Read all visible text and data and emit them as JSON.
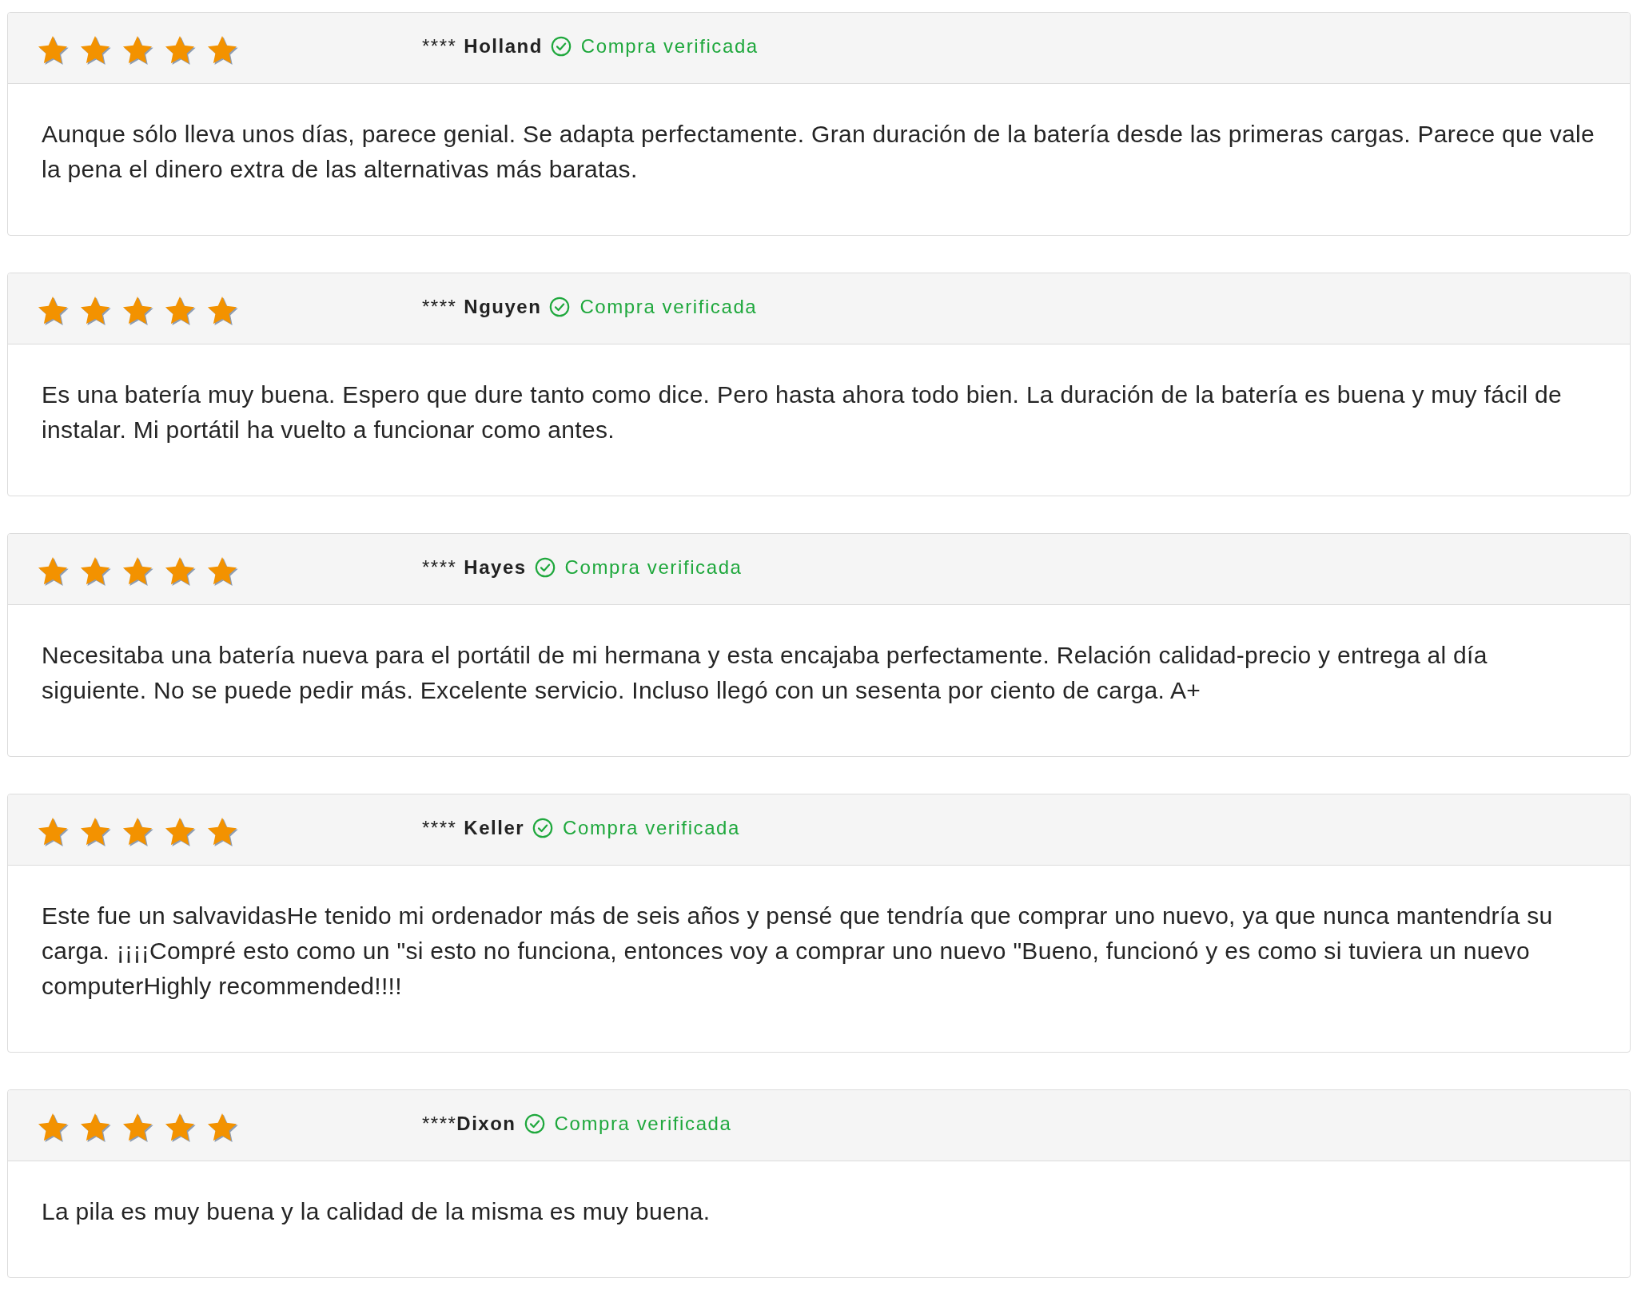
{
  "reviews": [
    {
      "stars": 5,
      "reviewer": {
        "mask": "****",
        "name": "Holland",
        "joined": false
      },
      "verified": true,
      "badge": "Compra verificada",
      "text": "Aunque sólo lleva unos días, parece genial. Se adapta perfectamente. Gran duración de la batería desde las primeras cargas. Parece que vale la pena el dinero extra de las alternativas más baratas."
    },
    {
      "stars": 5,
      "reviewer": {
        "mask": "****",
        "name": "Nguyen",
        "joined": false
      },
      "verified": true,
      "badge": "Compra verificada",
      "text": "Es una batería muy buena. Espero que dure tanto como dice. Pero hasta ahora todo bien. La duración de la batería es buena y muy fácil de instalar. Mi portátil ha vuelto a funcionar como antes."
    },
    {
      "stars": 5,
      "reviewer": {
        "mask": "****",
        "name": "Hayes",
        "joined": false
      },
      "verified": true,
      "badge": "Compra verificada",
      "text": "Necesitaba una batería nueva para el portátil de mi hermana y esta encajaba perfectamente. Relación calidad-precio y entrega al día siguiente. No se puede pedir más. Excelente servicio. Incluso llegó con un sesenta por ciento de carga. A+"
    },
    {
      "stars": 5,
      "reviewer": {
        "mask": "****",
        "name": "Keller",
        "joined": false
      },
      "verified": true,
      "badge": "Compra verificada",
      "text": "Este fue un salvavidasHe tenido mi ordenador más de seis años y pensé que tendría que comprar uno nuevo, ya que nunca mantendría su carga. ¡¡¡¡Compré esto como un \"si esto no funciona, entonces voy a comprar uno nuevo \"Bueno, funcionó y es como si tuviera un nuevo computerHighly recommended!!!!"
    },
    {
      "stars": 5,
      "reviewer": {
        "mask": "****",
        "name": "Dixon",
        "joined": true
      },
      "verified": true,
      "badge": "Compra verificada",
      "text": "La pila es muy buena y la calidad de la misma es muy buena."
    }
  ]
}
